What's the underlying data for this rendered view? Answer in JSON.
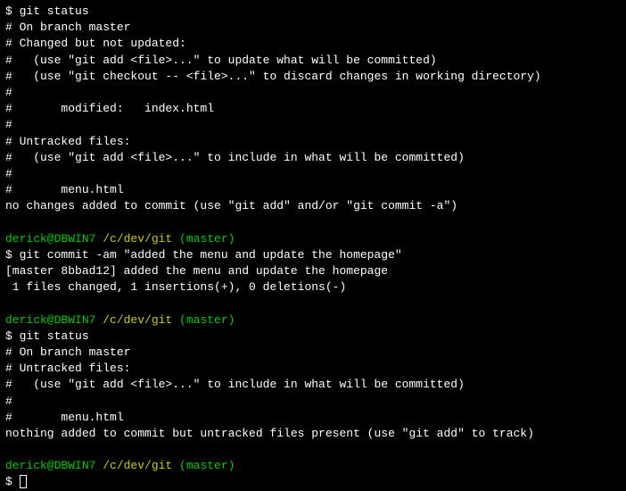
{
  "block1": {
    "cmd": "$ git status",
    "l1": "# On branch master",
    "l2": "# Changed but not updated:",
    "l3": "#   (use \"git add <file>...\" to update what will be committed)",
    "l4": "#   (use \"git checkout -- <file>...\" to discard changes in working directory)",
    "l5": "#",
    "l6": "#       modified:   index.html",
    "l7": "#",
    "l8": "# Untracked files:",
    "l9": "#   (use \"git add <file>...\" to include in what will be committed)",
    "l10": "#",
    "l11": "#       menu.html",
    "l12": "no changes added to commit (use \"git add\" and/or \"git commit -a\")"
  },
  "prompt1": {
    "user": "derick@DBWIN7",
    "path": " /c/dev/git",
    "branch": " (master)"
  },
  "block2": {
    "cmd": "$ git commit -am \"added the menu and update the homepage\"",
    "l1": "[master 8bbad12] added the menu and update the homepage",
    "l2": " 1 files changed, 1 insertions(+), 0 deletions(-)"
  },
  "prompt2": {
    "user": "derick@DBWIN7",
    "path": " /c/dev/git",
    "branch": " (master)"
  },
  "block3": {
    "cmd": "$ git status",
    "l1": "# On branch master",
    "l2": "# Untracked files:",
    "l3": "#   (use \"git add <file>...\" to include in what will be committed)",
    "l4": "#",
    "l5": "#       menu.html",
    "l6": "nothing added to commit but untracked files present (use \"git add\" to track)"
  },
  "prompt3": {
    "user": "derick@DBWIN7",
    "path": " /c/dev/git",
    "branch": " (master)"
  },
  "final": {
    "dollar": "$ "
  }
}
